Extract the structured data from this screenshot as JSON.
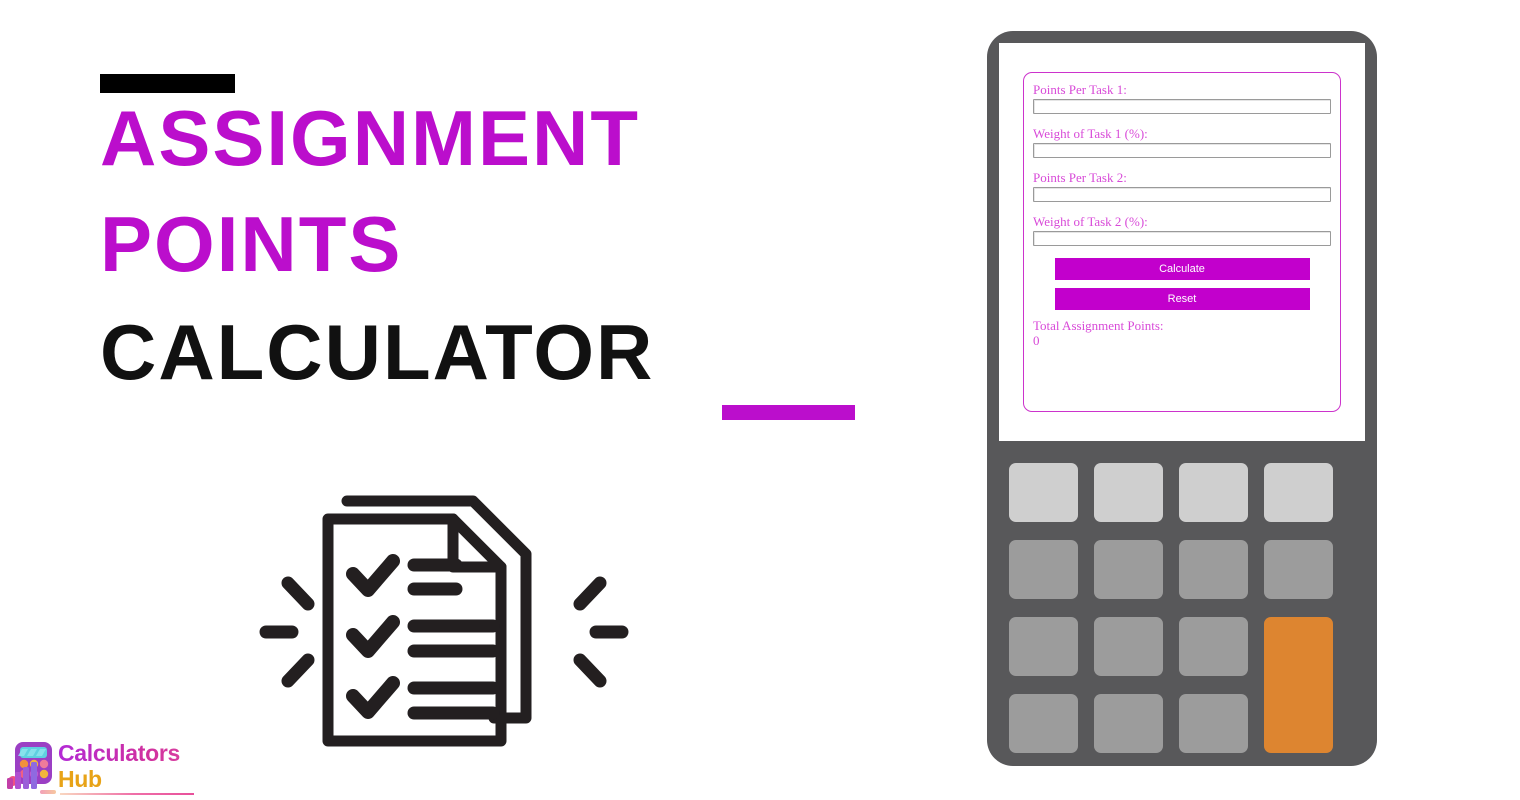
{
  "hero": {
    "title_lines": [
      {
        "text": "ASSIGNMENT",
        "color": "#bb0ecc"
      },
      {
        "text": "POINTS",
        "color": "#bb0ecc"
      },
      {
        "text": "CALCULATOR",
        "color": "#111111"
      }
    ],
    "accent_top_color": "#000000",
    "accent_bottom_color": "#bb0ecc",
    "illustration_name": "checklist-documents-illustration"
  },
  "logo": {
    "word_primary": "Calculators",
    "word_secondary": "Hub",
    "primary_color": "#b32ad6",
    "secondary_color": "#e8a317",
    "icon_name": "calculator-barchart-logo-icon"
  },
  "calculator": {
    "body_color": "#58585a",
    "screen_color": "#ffffff",
    "form": {
      "border_color": "#cc33cc",
      "label_color": "#d84ad8",
      "fields": [
        {
          "label": "Points Per Task 1:",
          "value": "",
          "placeholder": "",
          "name": "points-per-task-1-input"
        },
        {
          "label": "Weight of Task 1 (%):",
          "value": "",
          "placeholder": "",
          "name": "weight-of-task-1-input"
        },
        {
          "label": "Points Per Task 2:",
          "value": "",
          "placeholder": "",
          "name": "points-per-task-2-input"
        },
        {
          "label": "Weight of Task 2 (%):",
          "value": "",
          "placeholder": "",
          "name": "weight-of-task-2-input"
        }
      ],
      "calculate_label": "Calculate",
      "reset_label": "Reset",
      "button_color": "#c200cc",
      "result_label": "Total Assignment Points:",
      "result_value": "0"
    },
    "keypad": {
      "rows": 4,
      "cols": 4,
      "light_key_color": "#cfcfcf",
      "key_color": "#9c9c9c",
      "accent_key_color": "#dd8530"
    }
  }
}
